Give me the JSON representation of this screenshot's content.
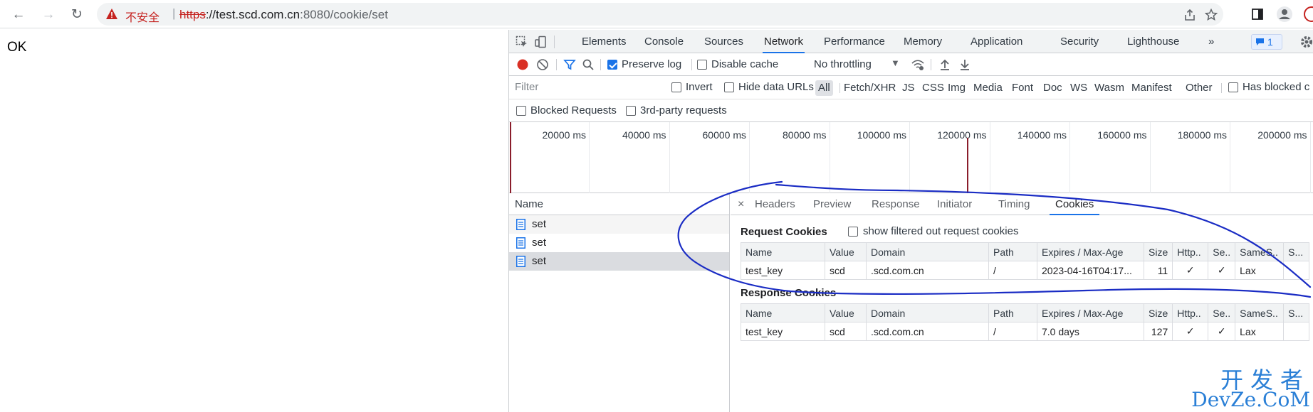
{
  "browser": {
    "security_label": "不安全",
    "url_scheme": "https",
    "url_host": "://test.scd.com.cn",
    "url_rest": ":8080/cookie/set"
  },
  "page": {
    "body_text": "OK"
  },
  "devtools": {
    "tabs": [
      "Elements",
      "Console",
      "Sources",
      "Network",
      "Performance",
      "Memory",
      "Application",
      "Security",
      "Lighthouse"
    ],
    "active_tab": "Network",
    "more_tabs": "»",
    "issues_count": "1",
    "toolbar": {
      "preserve_log": "Preserve log",
      "disable_cache": "Disable cache",
      "throttling": "No throttling"
    },
    "filter": {
      "placeholder": "Filter",
      "invert": "Invert",
      "hide_data_urls": "Hide data URLs",
      "types": [
        "All",
        "Fetch/XHR",
        "JS",
        "CSS",
        "Img",
        "Media",
        "Font",
        "Doc",
        "WS",
        "Wasm",
        "Manifest",
        "Other"
      ],
      "has_blocked": "Has blocked c",
      "blocked_requests": "Blocked Requests",
      "third_party": "3rd-party requests"
    },
    "timeline_ticks": [
      "20000 ms",
      "40000 ms",
      "60000 ms",
      "80000 ms",
      "100000 ms",
      "120000 ms",
      "140000 ms",
      "160000 ms",
      "180000 ms",
      "200000 ms"
    ],
    "requests": {
      "header": "Name",
      "items": [
        "set",
        "set",
        "set"
      ]
    },
    "details": {
      "close": "×",
      "tabs": [
        "Headers",
        "Preview",
        "Response",
        "Initiator",
        "Timing",
        "Cookies"
      ],
      "active_tab": "Cookies",
      "request_cookies_title": "Request Cookies",
      "show_filtered": "show filtered out request cookies",
      "response_cookies_title": "Response Cookies",
      "columns": [
        "Name",
        "Value",
        "Domain",
        "Path",
        "Expires / Max-Age",
        "Size",
        "Http..",
        "Se..",
        "SameS..",
        "S..."
      ],
      "request_cookies": [
        [
          "test_key",
          "scd",
          ".scd.com.cn",
          "/",
          "2023-04-16T04:17...",
          "11",
          "✓",
          "✓",
          "Lax",
          ""
        ]
      ],
      "response_cookies": [
        [
          "test_key",
          "scd",
          ".scd.com.cn",
          "/",
          "7.0 days",
          "127",
          "✓",
          "✓",
          "Lax",
          ""
        ]
      ]
    }
  },
  "watermark": {
    "cn": "开发者",
    "en": "DevZe.CoM"
  },
  "colors": {
    "accent": "#1a73e8",
    "danger": "#c5221f",
    "ink": "#1a2cc4",
    "watermark": "#2a7fd6"
  }
}
